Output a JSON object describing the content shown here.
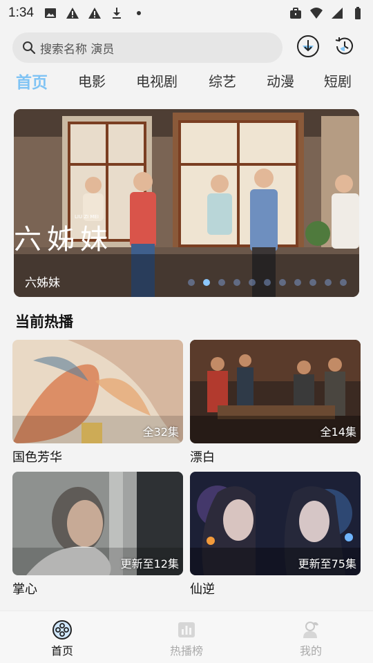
{
  "status_bar": {
    "time": "1:34"
  },
  "search": {
    "placeholder": "搜索名称 演员"
  },
  "tabs": [
    {
      "label": "首页",
      "active": true
    },
    {
      "label": "电影",
      "active": false
    },
    {
      "label": "电视剧",
      "active": false
    },
    {
      "label": "综艺",
      "active": false
    },
    {
      "label": "动漫",
      "active": false
    },
    {
      "label": "短剧",
      "active": false
    }
  ],
  "banner": {
    "logo_text": "六姊妹",
    "logo_pinyin": "LIU ZI MEI",
    "title": "六姊妹",
    "total_slides": 11,
    "active_slide": 2
  },
  "section": {
    "title": "当前热播"
  },
  "cards": [
    {
      "title": "国色芳华",
      "badge": "全32集"
    },
    {
      "title": "漂白",
      "badge": "全14集"
    },
    {
      "title": "掌心",
      "badge": "更新至12集"
    },
    {
      "title": "仙逆",
      "badge": "更新至75集"
    }
  ],
  "bottom_nav": [
    {
      "label": "首页",
      "icon": "film-reel-icon",
      "active": true
    },
    {
      "label": "热播榜",
      "icon": "chart-icon",
      "active": false
    },
    {
      "label": "我的",
      "icon": "profile-icon",
      "active": false
    }
  ],
  "colors": {
    "accent": "#7fc3f4",
    "background": "#f3f3f3",
    "search_bg": "#e6e6e6"
  }
}
